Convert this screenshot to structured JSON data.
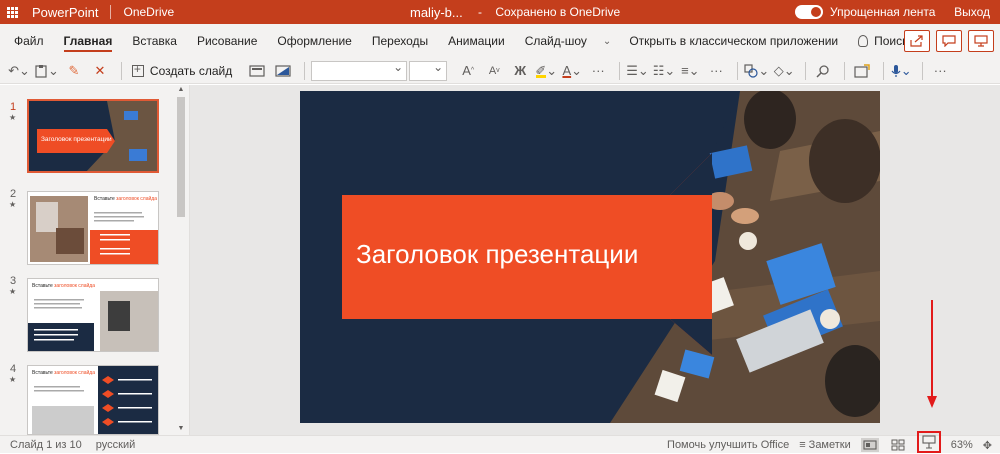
{
  "titlebar": {
    "app_name": "PowerPoint",
    "onedrive": "OneDrive",
    "doc_name": "maliy-b...",
    "dash": "-",
    "save_status": "Сохранено в OneDrive",
    "simplified_ribbon": "Упрощенная лента",
    "exit": "Выход"
  },
  "menu": {
    "tabs": [
      "Файл",
      "Главная",
      "Вставка",
      "Рисование",
      "Оформление",
      "Переходы",
      "Анимации",
      "Слайд-шоу"
    ],
    "active_tab": "Главная",
    "open_classic": "Открыть в классическом приложении",
    "search": "Поиск"
  },
  "toolbar": {
    "create_slide": "Создать слайд",
    "bold": "Ж",
    "font_size_up": "A",
    "font_size_down": "A",
    "more": "···"
  },
  "slides": [
    {
      "num": "1",
      "star": "★"
    },
    {
      "num": "2",
      "star": "★"
    },
    {
      "num": "3",
      "star": "★"
    },
    {
      "num": "4",
      "star": "★"
    }
  ],
  "thumbs": {
    "t1_title": "Заголовок презентации",
    "t2_title_a": "Вставьте ",
    "t2_title_b": "заголовок слайда",
    "t3_title_a": "Вставьте ",
    "t3_title_b": "заголовок слайда",
    "t4_title_a": "Вставьте ",
    "t4_title_b": "заголовок слайда"
  },
  "slide_main": {
    "title": "Заголовок презентации"
  },
  "statusbar": {
    "slide_counter": "Слайд 1 из 10",
    "language": "русский",
    "feedback": "Помочь улучшить Office",
    "notes": "Заметки",
    "zoom": "63%"
  },
  "colors": {
    "brand": "#c43e1c",
    "slide_bg": "#1b2b43",
    "accent": "#ef4d25",
    "annotation": "#e21b1b"
  }
}
